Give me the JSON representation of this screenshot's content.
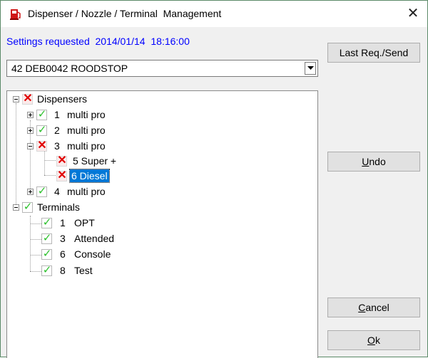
{
  "window": {
    "title": "Dispenser / Nozzle / Terminal  Management",
    "close_label": "✕"
  },
  "settings_text": "Settings requested  2014/01/14  18:16:00",
  "site_select": {
    "value": "42 DEB0042 ROODSTOP"
  },
  "tree": {
    "dispensers": {
      "label": "Dispensers",
      "items": [
        {
          "num": "1",
          "name": "multi pro"
        },
        {
          "num": "2",
          "name": "multi pro"
        },
        {
          "num": "3",
          "name": "multi pro",
          "nozzles": [
            {
              "label": "5 Super +"
            },
            {
              "label": "6 Diesel"
            }
          ]
        },
        {
          "num": "4",
          "name": "multi pro"
        }
      ]
    },
    "terminals": {
      "label": "Terminals",
      "items": [
        {
          "num": "1",
          "name": "OPT"
        },
        {
          "num": "3",
          "name": "Attended"
        },
        {
          "num": "6",
          "name": "Console"
        },
        {
          "num": "8",
          "name": "Test"
        }
      ]
    }
  },
  "buttons": {
    "last_req": "Last Req./Send",
    "undo_u": "U",
    "undo_rest": "ndo",
    "cancel_u": "C",
    "cancel_rest": "ancel",
    "ok_u": "O",
    "ok_rest": "k"
  }
}
